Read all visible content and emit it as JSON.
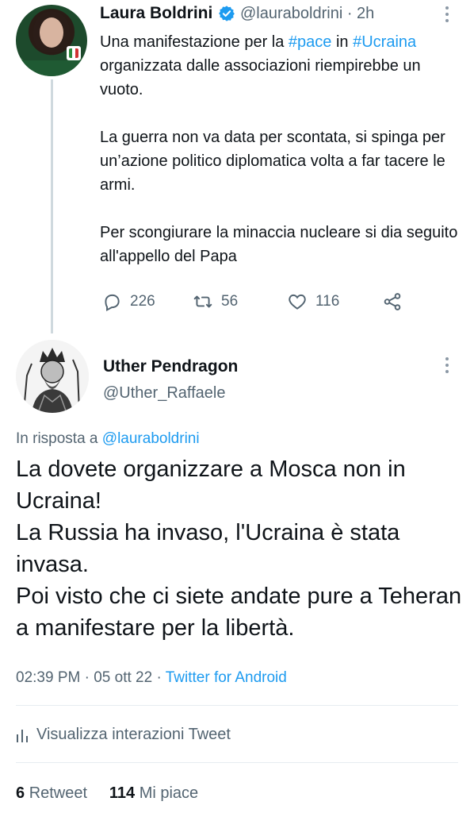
{
  "parent_tweet": {
    "author_name": "Laura Boldrini",
    "handle": "@lauraboldrini",
    "time": "· 2h",
    "paragraphs": {
      "p1_before": "Una manifestazione per la ",
      "p1_tag1": "#pace",
      "p1_mid": " in ",
      "p1_tag2": "#Ucraina",
      "p1_after": " organizzata dalle associazioni riempirebbe un vuoto.",
      "p2": "La guerra non va data per scontata, si spinga per un’azione politico diplomatica volta a far tacere le armi.",
      "p3": "Per scongiurare la minaccia nucleare si dia seguito all'appello del Papa"
    },
    "reply_count": "226",
    "retweet_count": "56",
    "like_count": "116"
  },
  "reply_tweet": {
    "author_name": "Uther Pendragon",
    "handle": "@Uther_Raffaele",
    "in_reply_prefix": "In risposta a ",
    "in_reply_handle": "@lauraboldrini",
    "lines": [
      "La dovete organizzare a Mosca non in Ucraina!",
      "La Russia ha invaso, l'Ucraina è stata invasa.",
      "Poi visto che ci siete andate pure a Teheran a manifestare per la libertà."
    ],
    "time": "02:39 PM",
    "date": "05 ott 22",
    "source": "Twitter for Android",
    "view_interactions": "Visualizza interazioni Tweet",
    "retweets_count": "6",
    "retweets_label": "Retweet",
    "likes_count": "114",
    "likes_label": "Mi piace"
  },
  "colors": {
    "link": "#1d9bf0",
    "muted": "#536471",
    "text": "#0f1419",
    "thread_line": "#cfd9de"
  },
  "icons": [
    "verified-badge-icon",
    "more-options-icon",
    "reply-icon",
    "retweet-icon",
    "like-icon",
    "share-icon",
    "analytics-icon"
  ]
}
